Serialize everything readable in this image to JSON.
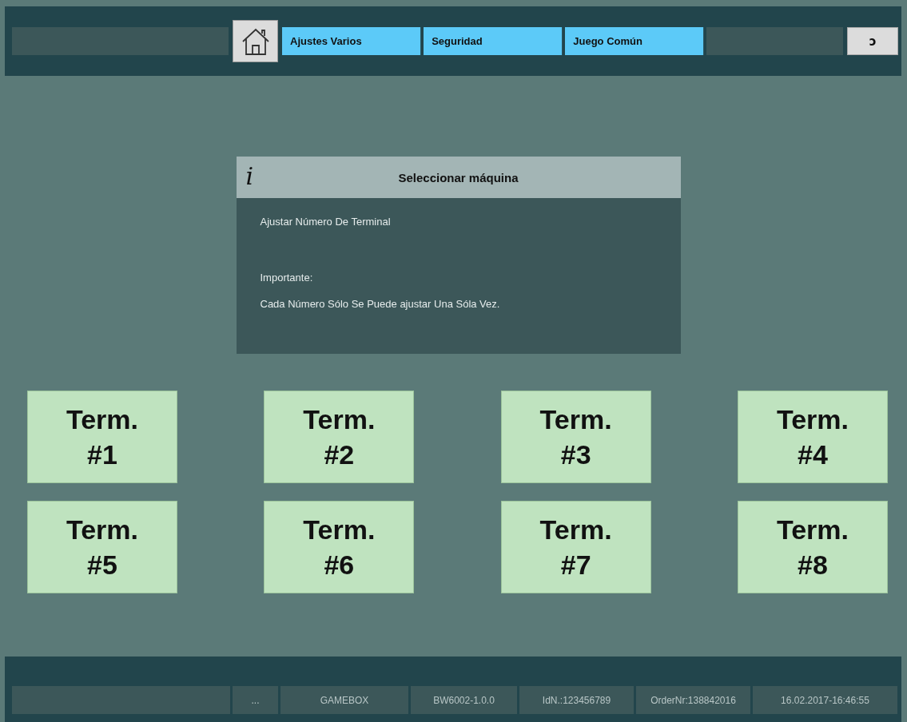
{
  "top_bar": {
    "tabs": [
      {
        "label": "Ajustes Varios"
      },
      {
        "label": "Seguridad"
      },
      {
        "label": "Juego Común"
      }
    ],
    "back_button": {
      "label": "ↄ"
    }
  },
  "dialog": {
    "icon": "i",
    "title": "Seleccionar máquina",
    "lines": [
      "Ajustar Número De Terminal",
      "Importante:",
      "Cada Número Sólo Se Puede ajustar Una Sóla Vez."
    ]
  },
  "terminals": [
    {
      "label": "Term.",
      "number": "#1"
    },
    {
      "label": "Term.",
      "number": "#2"
    },
    {
      "label": "Term.",
      "number": "#3"
    },
    {
      "label": "Term.",
      "number": "#4"
    },
    {
      "label": "Term.",
      "number": "#5"
    },
    {
      "label": "Term.",
      "number": "#6"
    },
    {
      "label": "Term.",
      "number": "#7"
    },
    {
      "label": "Term.",
      "number": "#8"
    }
  ],
  "status_bar": [
    "...",
    "GAMEBOX",
    "BW6002-1.0.0",
    "IdN.:123456789",
    "OrderNr:138842016",
    "16.02.2017-16:46:55"
  ]
}
